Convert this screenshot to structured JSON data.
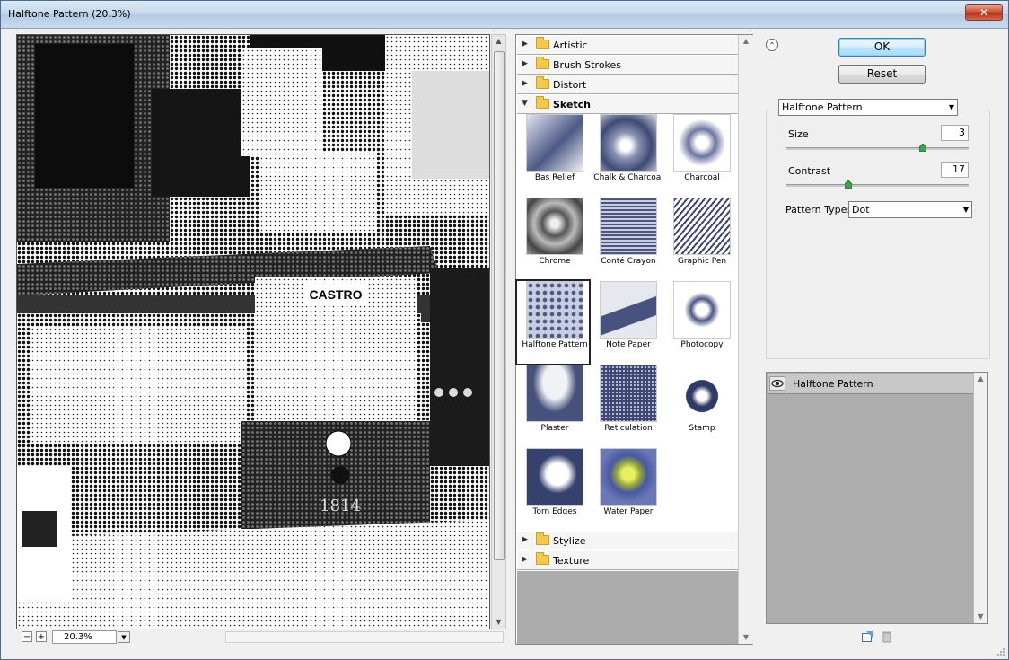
{
  "window": {
    "title": "Halftone Pattern (20.3%)"
  },
  "preview": {
    "sign_text": "CASTRO",
    "tram_number": "1814",
    "zoom_value": "20.3%"
  },
  "gallery": {
    "categories_top": [
      {
        "label": "Artistic",
        "open": false
      },
      {
        "label": "Brush Strokes",
        "open": false
      },
      {
        "label": "Distort",
        "open": false
      },
      {
        "label": "Sketch",
        "open": true
      }
    ],
    "sketch_filters": [
      {
        "label": "Bas Relief"
      },
      {
        "label": "Chalk & Charcoal"
      },
      {
        "label": "Charcoal"
      },
      {
        "label": "Chrome"
      },
      {
        "label": "Conté Crayon"
      },
      {
        "label": "Graphic Pen"
      },
      {
        "label": "Halftone Pattern",
        "selected": true
      },
      {
        "label": "Note Paper"
      },
      {
        "label": "Photocopy"
      },
      {
        "label": "Plaster"
      },
      {
        "label": "Reticulation"
      },
      {
        "label": "Stamp"
      },
      {
        "label": "Torn Edges"
      },
      {
        "label": "Water Paper"
      }
    ],
    "categories_bottom": [
      {
        "label": "Stylize",
        "open": false
      },
      {
        "label": "Texture",
        "open": false
      }
    ]
  },
  "buttons": {
    "ok": "OK",
    "reset": "Reset"
  },
  "settings": {
    "filter_select": "Halftone Pattern",
    "size_label": "Size",
    "size_value": "3",
    "size_slider": 0.75,
    "contrast_label": "Contrast",
    "contrast_value": "17",
    "contrast_slider": 0.34,
    "pattern_type_label": "Pattern Type:",
    "pattern_type_value": "Dot"
  },
  "layers": {
    "items": [
      {
        "label": "Halftone Pattern"
      }
    ]
  },
  "colors": {
    "accent": "#3c7fb1",
    "selected_border": "#222222"
  }
}
